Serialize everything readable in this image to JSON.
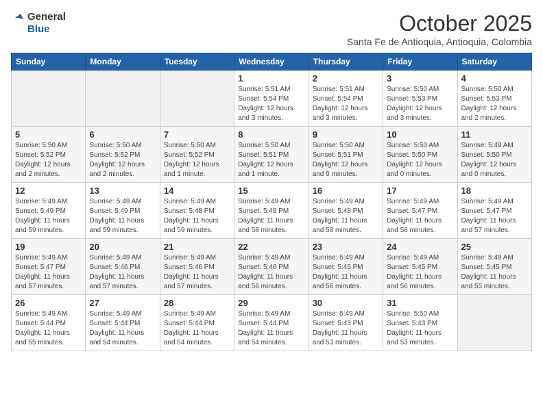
{
  "header": {
    "logo_general": "General",
    "logo_blue": "Blue",
    "title": "October 2025",
    "location": "Santa Fe de Antioquia, Antioquia, Colombia"
  },
  "days_of_week": [
    "Sunday",
    "Monday",
    "Tuesday",
    "Wednesday",
    "Thursday",
    "Friday",
    "Saturday"
  ],
  "weeks": [
    {
      "shade": false,
      "days": [
        {
          "number": "",
          "info": ""
        },
        {
          "number": "",
          "info": ""
        },
        {
          "number": "",
          "info": ""
        },
        {
          "number": "1",
          "info": "Sunrise: 5:51 AM\nSunset: 5:54 PM\nDaylight: 12 hours\nand 3 minutes."
        },
        {
          "number": "2",
          "info": "Sunrise: 5:51 AM\nSunset: 5:54 PM\nDaylight: 12 hours\nand 3 minutes."
        },
        {
          "number": "3",
          "info": "Sunrise: 5:50 AM\nSunset: 5:53 PM\nDaylight: 12 hours\nand 3 minutes."
        },
        {
          "number": "4",
          "info": "Sunrise: 5:50 AM\nSunset: 5:53 PM\nDaylight: 12 hours\nand 2 minutes."
        }
      ]
    },
    {
      "shade": true,
      "days": [
        {
          "number": "5",
          "info": "Sunrise: 5:50 AM\nSunset: 5:52 PM\nDaylight: 12 hours\nand 2 minutes."
        },
        {
          "number": "6",
          "info": "Sunrise: 5:50 AM\nSunset: 5:52 PM\nDaylight: 12 hours\nand 2 minutes."
        },
        {
          "number": "7",
          "info": "Sunrise: 5:50 AM\nSunset: 5:52 PM\nDaylight: 12 hours\nand 1 minute."
        },
        {
          "number": "8",
          "info": "Sunrise: 5:50 AM\nSunset: 5:51 PM\nDaylight: 12 hours\nand 1 minute."
        },
        {
          "number": "9",
          "info": "Sunrise: 5:50 AM\nSunset: 5:51 PM\nDaylight: 12 hours\nand 0 minutes."
        },
        {
          "number": "10",
          "info": "Sunrise: 5:50 AM\nSunset: 5:50 PM\nDaylight: 12 hours\nand 0 minutes."
        },
        {
          "number": "11",
          "info": "Sunrise: 5:49 AM\nSunset: 5:50 PM\nDaylight: 12 hours\nand 0 minutes."
        }
      ]
    },
    {
      "shade": false,
      "days": [
        {
          "number": "12",
          "info": "Sunrise: 5:49 AM\nSunset: 5:49 PM\nDaylight: 11 hours\nand 59 minutes."
        },
        {
          "number": "13",
          "info": "Sunrise: 5:49 AM\nSunset: 5:49 PM\nDaylight: 11 hours\nand 59 minutes."
        },
        {
          "number": "14",
          "info": "Sunrise: 5:49 AM\nSunset: 5:48 PM\nDaylight: 11 hours\nand 59 minutes."
        },
        {
          "number": "15",
          "info": "Sunrise: 5:49 AM\nSunset: 5:48 PM\nDaylight: 11 hours\nand 58 minutes."
        },
        {
          "number": "16",
          "info": "Sunrise: 5:49 AM\nSunset: 5:48 PM\nDaylight: 11 hours\nand 58 minutes."
        },
        {
          "number": "17",
          "info": "Sunrise: 5:49 AM\nSunset: 5:47 PM\nDaylight: 11 hours\nand 58 minutes."
        },
        {
          "number": "18",
          "info": "Sunrise: 5:49 AM\nSunset: 5:47 PM\nDaylight: 11 hours\nand 57 minutes."
        }
      ]
    },
    {
      "shade": true,
      "days": [
        {
          "number": "19",
          "info": "Sunrise: 5:49 AM\nSunset: 5:47 PM\nDaylight: 11 hours\nand 57 minutes."
        },
        {
          "number": "20",
          "info": "Sunrise: 5:49 AM\nSunset: 5:46 PM\nDaylight: 11 hours\nand 57 minutes."
        },
        {
          "number": "21",
          "info": "Sunrise: 5:49 AM\nSunset: 5:46 PM\nDaylight: 11 hours\nand 57 minutes."
        },
        {
          "number": "22",
          "info": "Sunrise: 5:49 AM\nSunset: 5:46 PM\nDaylight: 11 hours\nand 56 minutes."
        },
        {
          "number": "23",
          "info": "Sunrise: 5:49 AM\nSunset: 5:45 PM\nDaylight: 11 hours\nand 56 minutes."
        },
        {
          "number": "24",
          "info": "Sunrise: 5:49 AM\nSunset: 5:45 PM\nDaylight: 11 hours\nand 56 minutes."
        },
        {
          "number": "25",
          "info": "Sunrise: 5:49 AM\nSunset: 5:45 PM\nDaylight: 11 hours\nand 55 minutes."
        }
      ]
    },
    {
      "shade": false,
      "days": [
        {
          "number": "26",
          "info": "Sunrise: 5:49 AM\nSunset: 5:44 PM\nDaylight: 11 hours\nand 55 minutes."
        },
        {
          "number": "27",
          "info": "Sunrise: 5:49 AM\nSunset: 5:44 PM\nDaylight: 11 hours\nand 54 minutes."
        },
        {
          "number": "28",
          "info": "Sunrise: 5:49 AM\nSunset: 5:44 PM\nDaylight: 11 hours\nand 54 minutes."
        },
        {
          "number": "29",
          "info": "Sunrise: 5:49 AM\nSunset: 5:44 PM\nDaylight: 11 hours\nand 54 minutes."
        },
        {
          "number": "30",
          "info": "Sunrise: 5:49 AM\nSunset: 5:43 PM\nDaylight: 11 hours\nand 53 minutes."
        },
        {
          "number": "31",
          "info": "Sunrise: 5:50 AM\nSunset: 5:43 PM\nDaylight: 11 hours\nand 53 minutes."
        },
        {
          "number": "",
          "info": ""
        }
      ]
    }
  ]
}
